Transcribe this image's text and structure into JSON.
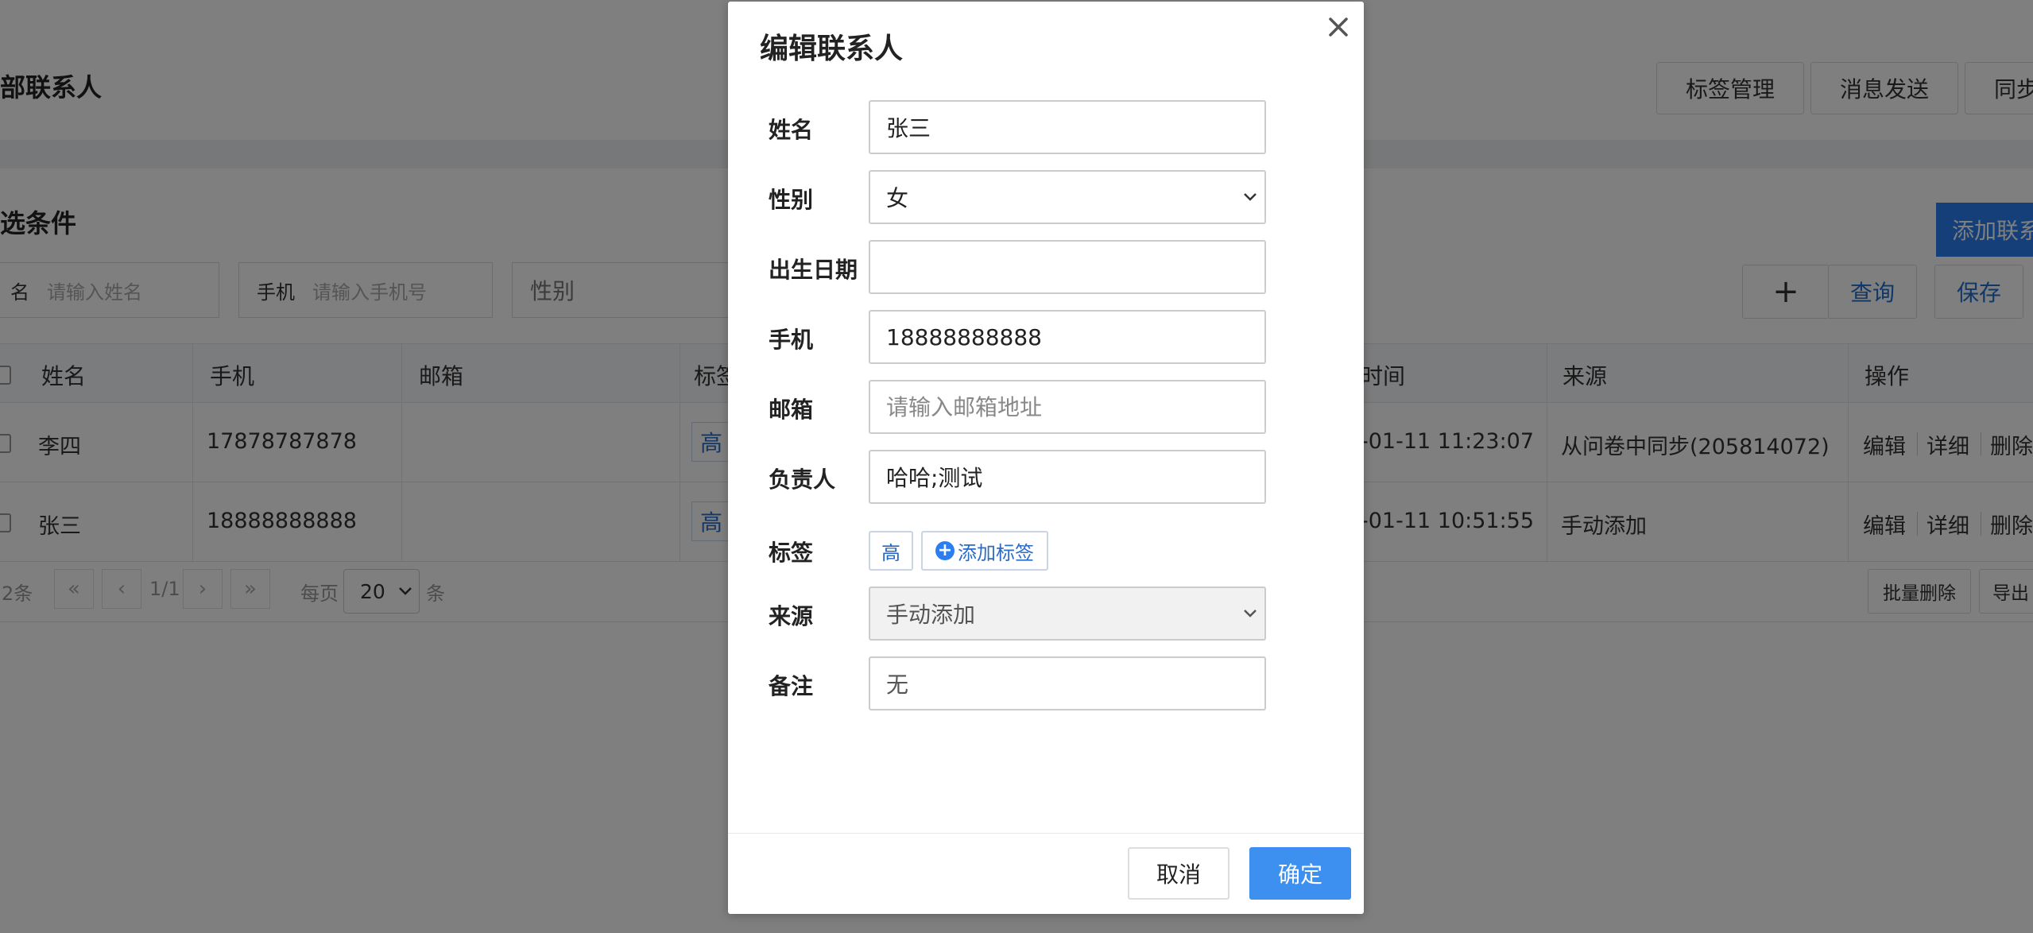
{
  "background": {
    "page_title": "部联系人",
    "top_buttons": [
      "标签管理",
      "消息发送",
      "同步"
    ],
    "section_title": "选条件",
    "add_contact_label": "添加联系",
    "filters": {
      "name_label": "名",
      "name_placeholder": "请输入姓名",
      "phone_label": "手机",
      "phone_placeholder": "请输入手机号",
      "gender_placeholder": "性别"
    },
    "actions": {
      "add_symbol": "+",
      "query": "查询",
      "save": "保存"
    },
    "table": {
      "headers": [
        "姓名",
        "手机",
        "邮箱",
        "标签",
        "时间",
        "来源",
        "操作"
      ],
      "rows": [
        {
          "name": "李四",
          "phone": "17878787878",
          "tag": "高",
          "time": "-01-11 11:23:07",
          "source": "从问卷中同步(205814072)"
        },
        {
          "name": "张三",
          "phone": "18888888888",
          "tag": "高",
          "time": "-01-11 10:51:55",
          "source": "手动添加"
        }
      ],
      "row_ops": [
        "编辑",
        "详细",
        "删除"
      ]
    },
    "pager": {
      "total": "2条",
      "first": "«",
      "prev": "‹",
      "page": "1/1",
      "next": "›",
      "last": "»",
      "per_page_label": "每页",
      "per_page_value": "20",
      "per_page_suffix": "条",
      "bulk_delete": "批量删除",
      "export": "导出"
    }
  },
  "modal": {
    "title": "编辑联系人",
    "fields": {
      "name": {
        "label": "姓名",
        "value": "张三"
      },
      "gender": {
        "label": "性别",
        "value": "女"
      },
      "birthday": {
        "label": "出生日期",
        "value": ""
      },
      "phone": {
        "label": "手机",
        "value": "18888888888"
      },
      "email": {
        "label": "邮箱",
        "value": "",
        "placeholder": "请输入邮箱地址"
      },
      "owner": {
        "label": "负责人",
        "value": "哈哈;测试"
      },
      "tags": {
        "label": "标签",
        "items": [
          "高"
        ],
        "add_label": "添加标签"
      },
      "source": {
        "label": "来源",
        "value": "手动添加"
      },
      "remark": {
        "label": "备注",
        "value": "无"
      }
    },
    "cancel_label": "取消",
    "ok_label": "确定"
  },
  "colors": {
    "primary": "#3d8ff0",
    "overlay": "rgba(0,0,0,0.5)",
    "link_blue": "#2a6cc6"
  }
}
